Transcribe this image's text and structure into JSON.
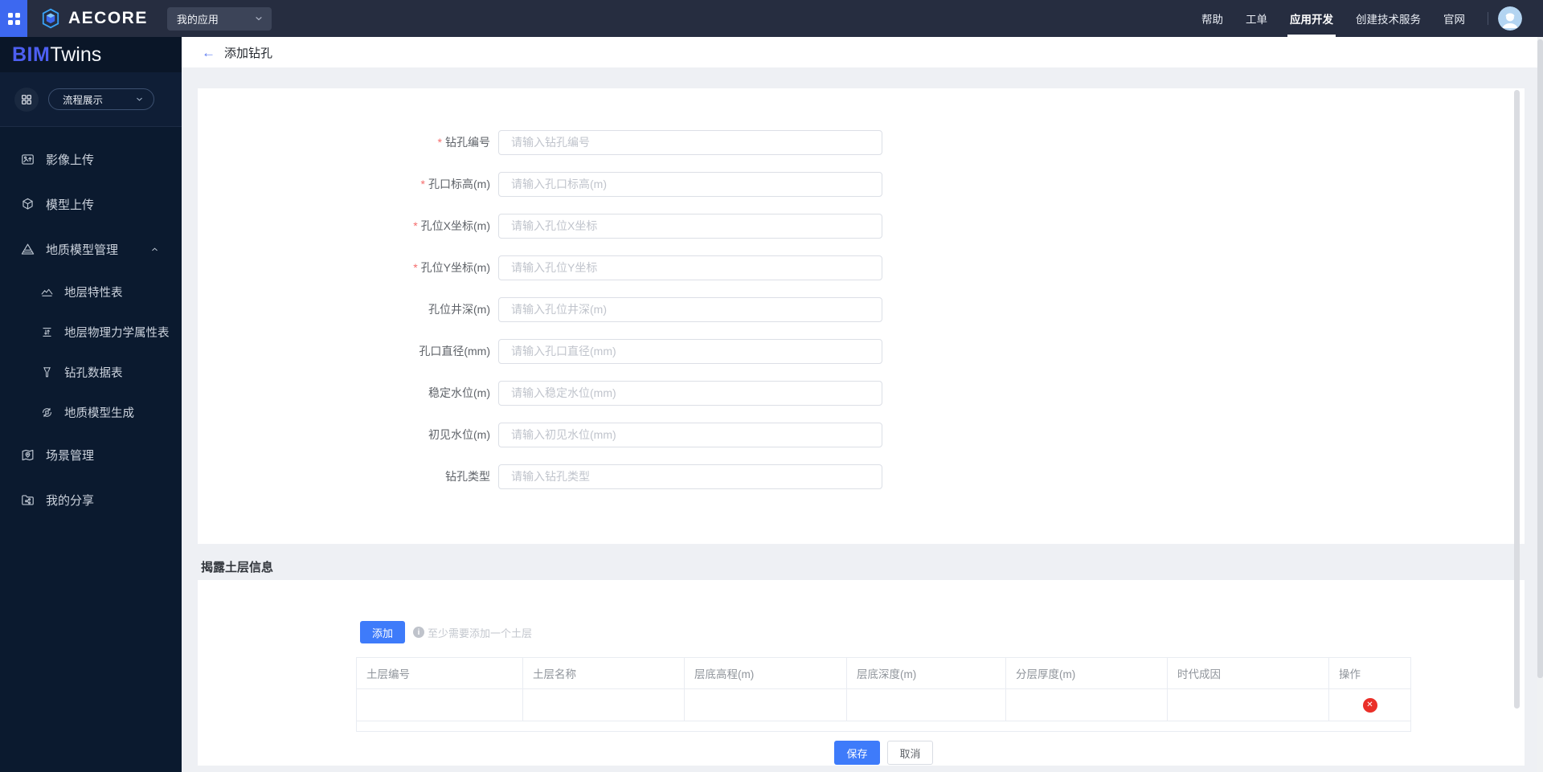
{
  "topbar": {
    "brand": "AECORE",
    "app_select": "我的应用",
    "links": [
      "帮助",
      "工单",
      "应用开发",
      "创建技术服务",
      "官网"
    ]
  },
  "sidebar": {
    "logo_primary": "BIM",
    "logo_secondary": "Twins",
    "mode_select": "流程展示",
    "items": [
      {
        "label": "影像上传"
      },
      {
        "label": "模型上传"
      },
      {
        "label": "地质模型管理",
        "expanded": true
      },
      {
        "label": "地层特性表"
      },
      {
        "label": "地层物理力学属性表"
      },
      {
        "label": "钻孔数据表"
      },
      {
        "label": "地质模型生成"
      },
      {
        "label": "场景管理"
      },
      {
        "label": "我的分享"
      }
    ]
  },
  "page": {
    "back": "←",
    "title": "添加钻孔"
  },
  "form": {
    "required_mark": "*",
    "fields": [
      {
        "label": "钻孔编号",
        "placeholder": "请输入钻孔编号",
        "required": true
      },
      {
        "label": "孔口标高(m)",
        "placeholder": "请输入孔口标高(m)",
        "required": true
      },
      {
        "label": "孔位X坐标(m)",
        "placeholder": "请输入孔位X坐标",
        "required": true
      },
      {
        "label": "孔位Y坐标(m)",
        "placeholder": "请输入孔位Y坐标",
        "required": true
      },
      {
        "label": "孔位井深(m)",
        "placeholder": "请输入孔位井深(m)",
        "required": false
      },
      {
        "label": "孔口直径(mm)",
        "placeholder": "请输入孔口直径(mm)",
        "required": false
      },
      {
        "label": "稳定水位(m)",
        "placeholder": "请输入稳定水位(mm)",
        "required": false
      },
      {
        "label": "初见水位(m)",
        "placeholder": "请输入初见水位(mm)",
        "required": false
      },
      {
        "label": "钻孔类型",
        "placeholder": "请输入钻孔类型",
        "required": false
      }
    ]
  },
  "soil": {
    "title": "揭露土层信息",
    "add": "添加",
    "info_icon": "i",
    "hint": "至少需要添加一个土层",
    "columns": [
      "土层编号",
      "土层名称",
      "层底高程(m)",
      "层底深度(m)",
      "分层厚度(m)",
      "时代成因",
      "操作"
    ],
    "delete_icon": "✕",
    "save": "保存",
    "cancel": "取消"
  },
  "colors": {
    "accent": "#3e7bfa",
    "danger": "#ea2f28",
    "required": "#f56c6c",
    "topbar_bg": "#262d40",
    "sidebar_bg": "#0b1a2f"
  }
}
